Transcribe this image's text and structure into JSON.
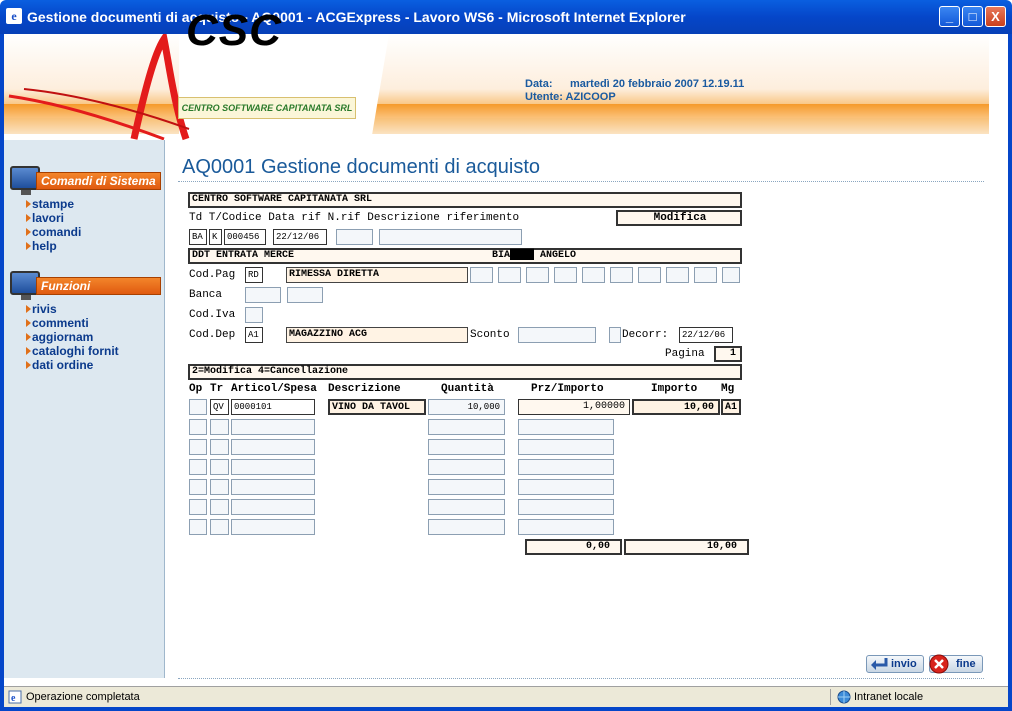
{
  "window": {
    "title": "Gestione documenti di acquisto - AQ0001 - ACGExpress - Lavoro WS6 - Microsoft Internet Explorer",
    "min": "_",
    "max": "□",
    "close": "X"
  },
  "header": {
    "logo_text": "CSC",
    "logo_subtitle": "CENTRO SOFTWARE CAPITANATA SRL",
    "data_label": "Data:",
    "data_value": "martedì 20 febbraio 2007 12.19.11",
    "utente_label": "Utente:",
    "utente_value": "AZICOOP"
  },
  "sidebar": {
    "sistema_title": "Comandi di Sistema",
    "sistema_items": [
      "stampe",
      "lavori",
      "comandi",
      "help"
    ],
    "funzioni_title": "Funzioni",
    "funzioni_items": [
      "rivis",
      "commenti",
      "aggiornam",
      "cataloghi fornit",
      "dati ordine"
    ]
  },
  "page": {
    "title": "AQ0001 Gestione documenti di acquisto"
  },
  "form": {
    "company": "CENTRO SOFTWARE CAPITANATA SRL",
    "hdr_labels": "Td T/Codice Data rif N.rif Descrizione riferimento",
    "mode": "Modifica",
    "td": "BA",
    "t": "K",
    "codice": "000456",
    "data_rif": "22/12/06",
    "doc_type": "DDT ENTRATA MERCE",
    "supplier": "BIA████ ANGELO",
    "cod_pag_label": "Cod.Pag",
    "cod_pag": "RD",
    "cod_pag_desc": "RIMESSA DIRETTA",
    "banca_label": "Banca",
    "cod_iva_label": "Cod.Iva",
    "cod_dep_label": "Cod.Dep",
    "cod_dep": "A1",
    "cod_dep_desc": "MAGAZZINO ACG",
    "sconto_label": "Sconto",
    "decorr_label": "Decorr:",
    "decorr": "22/12/06",
    "pagina_label": "Pagina",
    "pagina": "1",
    "legend": "2=Modifica  4=Cancellazione",
    "columns": [
      "Op",
      "Tr",
      "Articol/Spesa",
      "Descrizione",
      "Quantità",
      "Prz/Importo",
      "Importo",
      "Mg"
    ],
    "row1": {
      "tr": "QV",
      "articolo": "0000101",
      "descrizione": "VINO DA TAVOL",
      "quantita": "10,000",
      "prezzo": "1,00000",
      "importo": "10,00",
      "mg": "A1"
    },
    "total1": "0,00",
    "total2": "10,00"
  },
  "buttons": {
    "invio": "invio",
    "fine": "fine"
  },
  "status": {
    "message": "Operazione completata",
    "zone": "Intranet locale"
  },
  "colors": {
    "titlebar": "#0546c9",
    "accent": "#e05a10",
    "link": "#0b3a8c",
    "title": "#1a5a9a"
  }
}
